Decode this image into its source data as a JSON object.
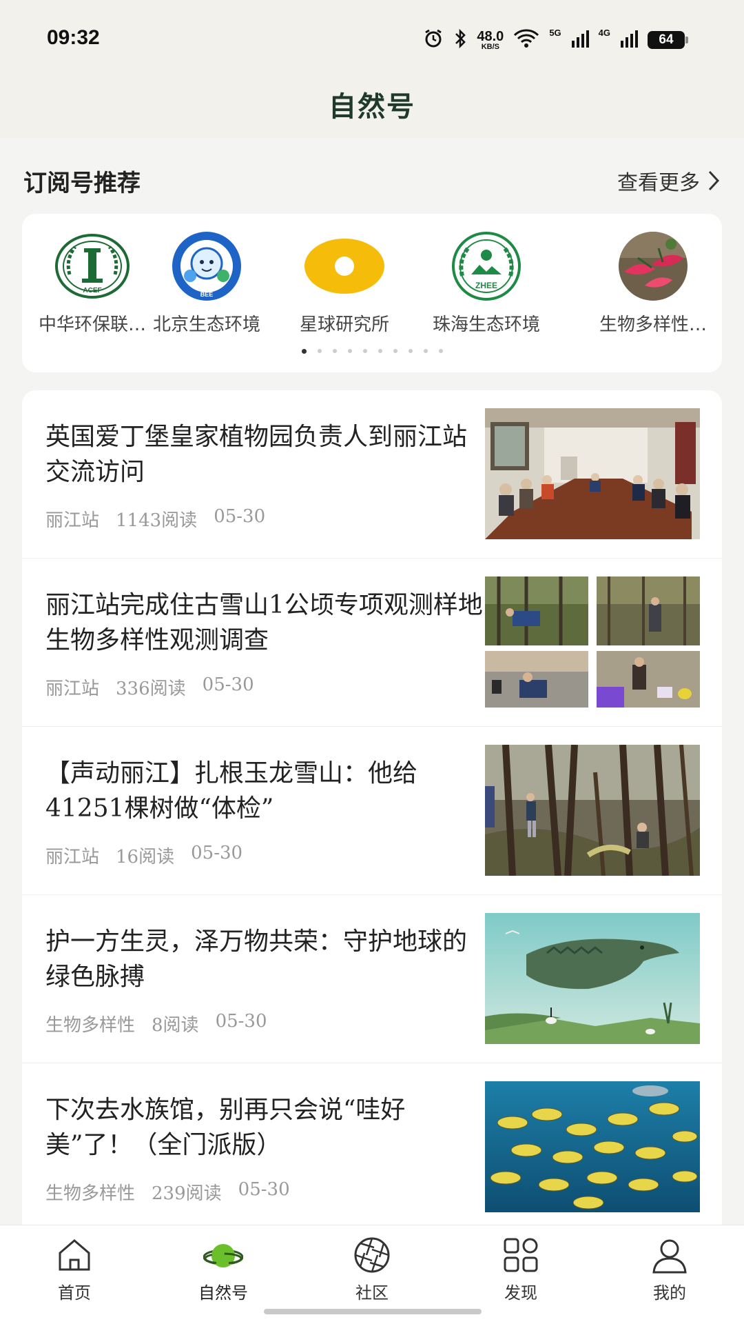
{
  "status_bar": {
    "time": "09:32",
    "net_speed": "48.0",
    "net_unit": "KB/S",
    "net_5g": "5G",
    "net_4g": "4G",
    "battery": "64"
  },
  "header": {
    "title": "自然号"
  },
  "recommend": {
    "title": "订阅号推荐",
    "more_label": "查看更多",
    "accounts": [
      {
        "name": "中华环保联…",
        "logo": "acef-logo"
      },
      {
        "name": "北京生态环境",
        "logo": "bee-logo"
      },
      {
        "name": "星球研究所",
        "logo": "yellow-ring-logo"
      },
      {
        "name": "珠海生态环境",
        "logo": "zhee-logo"
      },
      {
        "name": "生物多样性…",
        "logo": "plant-photo-logo"
      }
    ],
    "page_dots": 10,
    "active_dot": 0
  },
  "articles": [
    {
      "title": "英国爱丁堡皇家植物园负责人到丽江站交流访问",
      "source": "丽江站",
      "reads": "1143阅读",
      "date": "05-30",
      "thumb": "meeting-room-photo"
    },
    {
      "title": "丽江站完成住古雪山1公顷专项观测样地生物多样性观测调查",
      "source": "丽江站",
      "reads": "336阅读",
      "date": "05-30",
      "thumb": "fieldwork-collage"
    },
    {
      "title": "【声动丽江】扎根玉龙雪山：他给41251棵树做“体检”",
      "source": "丽江站",
      "reads": "16阅读",
      "date": "05-30",
      "thumb": "forest-photo"
    },
    {
      "title": "护一方生灵，泽万物共荣：守护地球的绿色脉搏",
      "source": "生物多样性",
      "reads": "8阅读",
      "date": "05-30",
      "thumb": "crocodile-poster"
    },
    {
      "title": "下次去水族馆，别再只会说“哇好美”了！（全门派版）",
      "source": "生物多样性",
      "reads": "239阅读",
      "date": "05-30",
      "thumb": "aquarium-fish-photo"
    }
  ],
  "tabbar": {
    "tabs": [
      {
        "label": "首页",
        "icon": "home-icon"
      },
      {
        "label": "自然号",
        "icon": "planet-icon"
      },
      {
        "label": "社区",
        "icon": "aperture-icon"
      },
      {
        "label": "发现",
        "icon": "grid-icon"
      },
      {
        "label": "我的",
        "icon": "person-icon"
      }
    ],
    "active": 1
  }
}
